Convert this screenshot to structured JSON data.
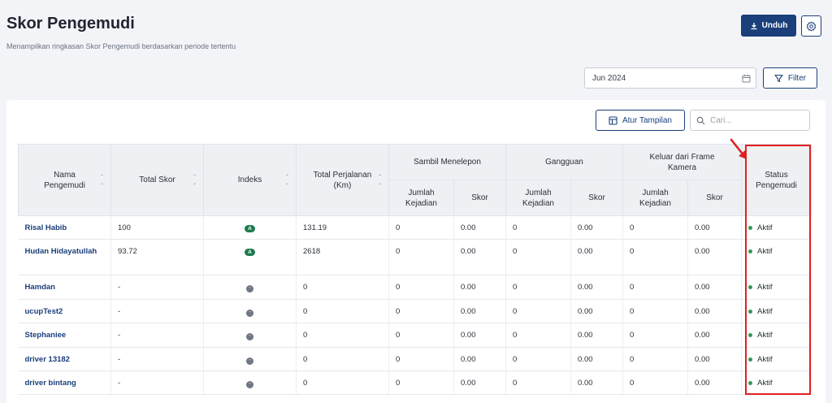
{
  "header": {
    "title": "Skor Pengemudi",
    "subtitle": "Menampilkan ringkasan Skor Pengemudi berdasarkan periode tertentu",
    "download_label": "Unduh"
  },
  "filters": {
    "date_value": "Jun 2024",
    "filter_label": "Filter",
    "view_label": "Atur Tampilan",
    "search_placeholder": "Cari..."
  },
  "table": {
    "headers": {
      "name": "Nama Pengemudi",
      "total_score": "Total Skor",
      "index": "Indeks",
      "total_trip": "Total Perjalanan (Km)",
      "group_phone": "Sambil Menelepon",
      "group_distraction": "Gangguan",
      "group_frame": "Keluar dari Frame Kamera",
      "incidents": "Jumlah Kejadian",
      "score": "Skor",
      "status": "Status Pengemudi"
    },
    "rows": [
      {
        "name": "Risal Habib",
        "total_score": "100",
        "index": "A",
        "trip": "131.19",
        "phone_inc": "0",
        "phone_score": "0.00",
        "dist_inc": "0",
        "dist_score": "0.00",
        "frame_inc": "0",
        "frame_score": "0.00",
        "status": "Aktif"
      },
      {
        "name": "Hudan Hidayatullah",
        "total_score": "93.72",
        "index": "A",
        "trip": "2618",
        "phone_inc": "0",
        "phone_score": "0.00",
        "dist_inc": "0",
        "dist_score": "0.00",
        "frame_inc": "0",
        "frame_score": "0.00",
        "status": "Aktif"
      },
      {
        "name": "Hamdan",
        "total_score": "-",
        "index": "-",
        "trip": "0",
        "phone_inc": "0",
        "phone_score": "0.00",
        "dist_inc": "0",
        "dist_score": "0.00",
        "frame_inc": "0",
        "frame_score": "0.00",
        "status": "Aktif"
      },
      {
        "name": "ucupTest2",
        "total_score": "-",
        "index": "-",
        "trip": "0",
        "phone_inc": "0",
        "phone_score": "0.00",
        "dist_inc": "0",
        "dist_score": "0.00",
        "frame_inc": "0",
        "frame_score": "0.00",
        "status": "Aktif"
      },
      {
        "name": "Stephaniee",
        "total_score": "-",
        "index": "-",
        "trip": "0",
        "phone_inc": "0",
        "phone_score": "0.00",
        "dist_inc": "0",
        "dist_score": "0.00",
        "frame_inc": "0",
        "frame_score": "0.00",
        "status": "Aktif"
      },
      {
        "name": "driver 13182",
        "total_score": "-",
        "index": "-",
        "trip": "0",
        "phone_inc": "0",
        "phone_score": "0.00",
        "dist_inc": "0",
        "dist_score": "0.00",
        "frame_inc": "0",
        "frame_score": "0.00",
        "status": "Aktif"
      },
      {
        "name": "driver bintang",
        "total_score": "-",
        "index": "-",
        "trip": "0",
        "phone_inc": "0",
        "phone_score": "0.00",
        "dist_inc": "0",
        "dist_score": "0.00",
        "frame_inc": "0",
        "frame_score": "0.00",
        "status": "Aktif"
      }
    ]
  },
  "colors": {
    "primary": "#1a3f7a",
    "active_status": "#2f9a5a",
    "badge_a": "#1f7a4d",
    "highlight": "#e02020"
  }
}
